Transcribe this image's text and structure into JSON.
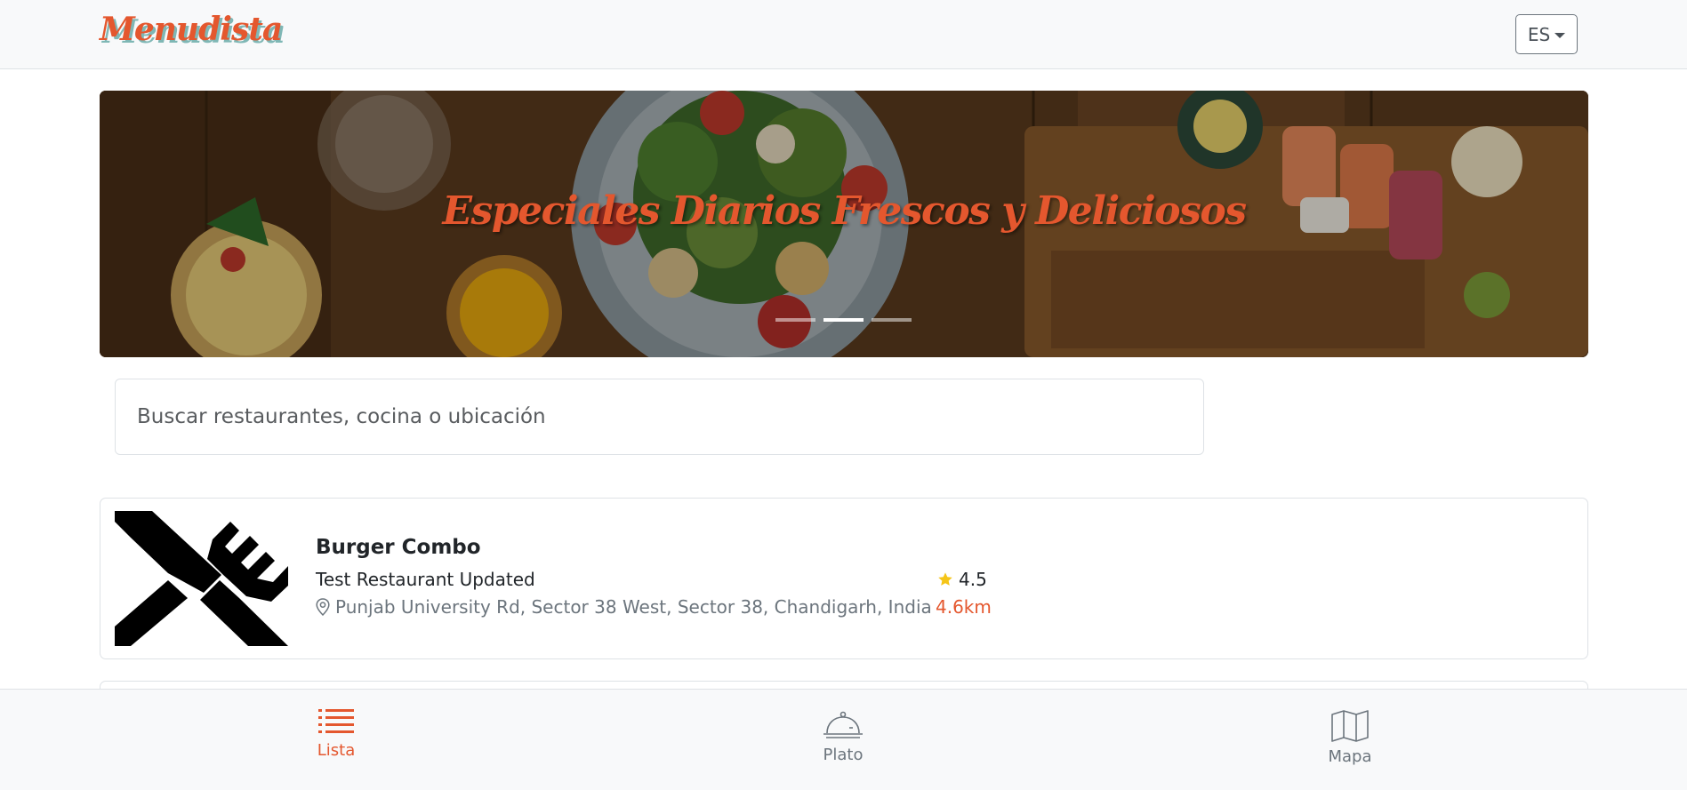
{
  "navbar": {
    "brand": "Menudista",
    "language": "ES"
  },
  "hero": {
    "title": "Especiales Diarios Frescos y Deliciosos",
    "slide_count": 3,
    "active_slide": 2
  },
  "search": {
    "placeholder": "Buscar restaurantes, cocina o ubicación",
    "value": ""
  },
  "restaurants": [
    {
      "dish": "Burger Combo",
      "restaurant": "Test Restaurant Updated",
      "rating": "4.5",
      "address": "Punjab University Rd, Sector 38 West, Sector 38, Chandigarh, India",
      "distance": "4.6km",
      "thumbnail_icon": "fork-knife-icon"
    }
  ],
  "bottom_nav": {
    "items": [
      {
        "label": "Lista",
        "icon": "list-icon",
        "active": true
      },
      {
        "label": "Plato",
        "icon": "cloche-icon",
        "active": false
      },
      {
        "label": "Mapa",
        "icon": "map-icon",
        "active": false
      }
    ]
  },
  "colors": {
    "accent": "#e4572e",
    "brand_shadow": "#7fb7b5",
    "muted_text": "#6c757d",
    "star": "#f5c518",
    "nav_background": "#f8f9fa"
  }
}
